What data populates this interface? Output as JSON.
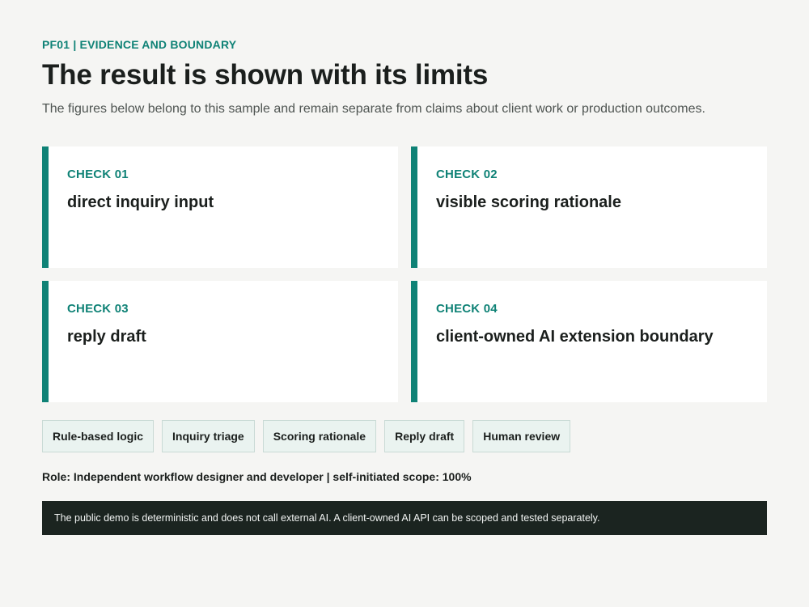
{
  "header": {
    "eyebrow": "PF01 | EVIDENCE AND BOUNDARY",
    "title": "The result is shown with its limits",
    "subtitle": "The figures below belong to this sample and remain separate from claims about client work or production outcomes."
  },
  "checks": [
    {
      "label": "CHECK 01",
      "text": "direct inquiry input"
    },
    {
      "label": "CHECK 02",
      "text": "visible scoring rationale"
    },
    {
      "label": "CHECK 03",
      "text": "reply draft"
    },
    {
      "label": "CHECK 04",
      "text": "client-owned AI extension boundary"
    }
  ],
  "tags": [
    "Rule-based logic",
    "Inquiry triage",
    "Scoring rationale",
    "Reply draft",
    "Human review"
  ],
  "role": "Role: Independent workflow designer and developer | self-initiated scope: 100%",
  "note": "The public demo is deterministic and does not call external AI. A client-owned AI API can be scoped and tested separately.",
  "colors": {
    "accent": "#0f8276",
    "background": "#f5f5f3",
    "note_background": "#1b2420",
    "tag_background": "#eaf3f0"
  }
}
